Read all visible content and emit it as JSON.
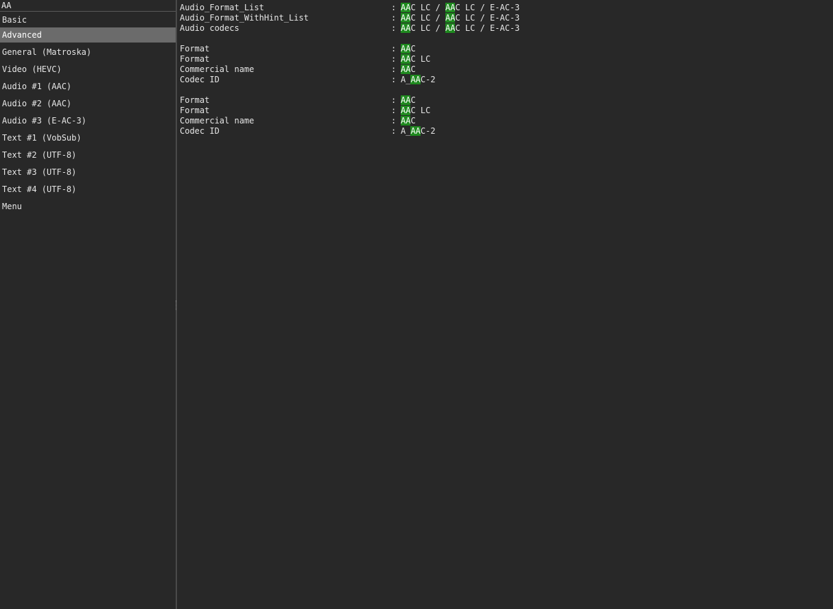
{
  "search": {
    "value": "AA"
  },
  "sidebar": {
    "items": [
      {
        "label": "Basic",
        "selected": false
      },
      {
        "label": "Advanced",
        "selected": true
      },
      {
        "label": "General (Matroska)",
        "selected": false
      },
      {
        "label": "Video (HEVC)",
        "selected": false
      },
      {
        "label": "Audio #1 (AAC)",
        "selected": false
      },
      {
        "label": "Audio #2 (AAC)",
        "selected": false
      },
      {
        "label": "Audio #3 (E-AC-3)",
        "selected": false
      },
      {
        "label": "Text #1 (VobSub)",
        "selected": false
      },
      {
        "label": "Text #2 (UTF-8)",
        "selected": false
      },
      {
        "label": "Text #3 (UTF-8)",
        "selected": false
      },
      {
        "label": "Text #4 (UTF-8)",
        "selected": false
      },
      {
        "label": "Menu",
        "selected": false
      }
    ]
  },
  "highlight_term": "AA",
  "colors": {
    "highlight": "#1f8a1f",
    "background": "#282828",
    "selected": "#6b6b6b"
  },
  "content": {
    "separator": ":",
    "sections": [
      {
        "rows": [
          {
            "key": "Audio_Format_List",
            "value": "AAC LC / AAC LC / E-AC-3"
          },
          {
            "key": "Audio_Format_WithHint_List",
            "value": "AAC LC / AAC LC / E-AC-3"
          },
          {
            "key": "Audio codecs",
            "value": "AAC LC / AAC LC / E-AC-3"
          }
        ]
      },
      {
        "rows": [
          {
            "key": "Format",
            "value": "AAC"
          },
          {
            "key": "Format",
            "value": "AAC LC"
          },
          {
            "key": "Commercial name",
            "value": "AAC"
          },
          {
            "key": "Codec ID",
            "value": "A_AAC-2"
          }
        ]
      },
      {
        "rows": [
          {
            "key": "Format",
            "value": "AAC"
          },
          {
            "key": "Format",
            "value": "AAC LC"
          },
          {
            "key": "Commercial name",
            "value": "AAC"
          },
          {
            "key": "Codec ID",
            "value": "A_AAC-2"
          }
        ]
      }
    ]
  }
}
